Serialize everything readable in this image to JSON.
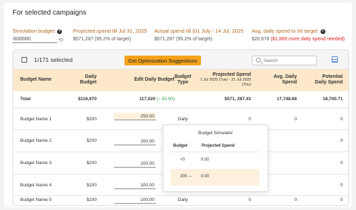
{
  "heading": "For selected campaigns",
  "metrics": [
    {
      "label": "Simulation budget:",
      "value": "600000"
    },
    {
      "label": "Projected spend till Jul 31, 2025",
      "value": "$571,287 (95.2% of target)"
    },
    {
      "label": "Actual spend till (01 July - 14 Jul, 2025",
      "value": "$571,287 (95.2% of target)"
    },
    {
      "label": "Avg. daily spend to hit target:",
      "value": "$20,678",
      "value_extra": "($1,889 more daily spend needed)"
    }
  ],
  "toolbar": {
    "selected_count": "1/171 selected",
    "suggest_label": "Get Optimization Suggestions",
    "search_placeholder": "Search"
  },
  "columns": {
    "budget_name": "Budget Name",
    "daily_budget": "Daily Budget",
    "edit_daily_budget": "Edit Daily Budget",
    "budget_type": "Budget Type",
    "projected_spend": "Projected Spend",
    "projected_spend_sub": "1 Jul 2025 (Tue) - 31 Jul 2025 (Thu)",
    "avg_daily_spend": "Avg. Daily Spend",
    "potential_daily_spend": "Potential Daily Spend"
  },
  "total": {
    "name": "Total",
    "daily_budget": "$116,970",
    "edit_value": "117,020",
    "edit_delta": "(↑ 50.00)",
    "projected": "$571, 287.43",
    "avg": "17,748.68",
    "potential": "18,700.71"
  },
  "rows": [
    {
      "name": "Budget Name 1",
      "daily_budget": "$200",
      "edit": "250.00",
      "type": "Daily",
      "projected": "0",
      "avg": "0",
      "potential": "0",
      "active": true
    },
    {
      "name": "Budget Name 2",
      "daily_budget": "$200",
      "edit": "200.00",
      "type": "",
      "projected": "",
      "avg": "",
      "potential": "0",
      "active": false
    },
    {
      "name": "Budget Name 3",
      "daily_budget": "$200",
      "edit": "200.00",
      "type": "",
      "projected": "",
      "avg": "",
      "potential": "0",
      "active": false
    },
    {
      "name": "Budget Name 4",
      "daily_budget": "$100",
      "edit": "100.00",
      "type": "",
      "projected": "",
      "avg": "",
      "potential": "0",
      "active": false
    },
    {
      "name": "Budget Name 5",
      "daily_budget": "$100",
      "edit": "100.00",
      "type": "Daily",
      "projected": "0",
      "avg": "0",
      "potential": "0",
      "active": false
    }
  ],
  "simulator": {
    "title": "Budget Simulator",
    "col_budget": "Budget",
    "col_projected": "Projected Spend",
    "rows": [
      {
        "budget": "+0",
        "spend": "0.00",
        "highlight": false
      },
      {
        "budget": "200 ---",
        "spend": "0.00",
        "highlight": true
      }
    ]
  }
}
